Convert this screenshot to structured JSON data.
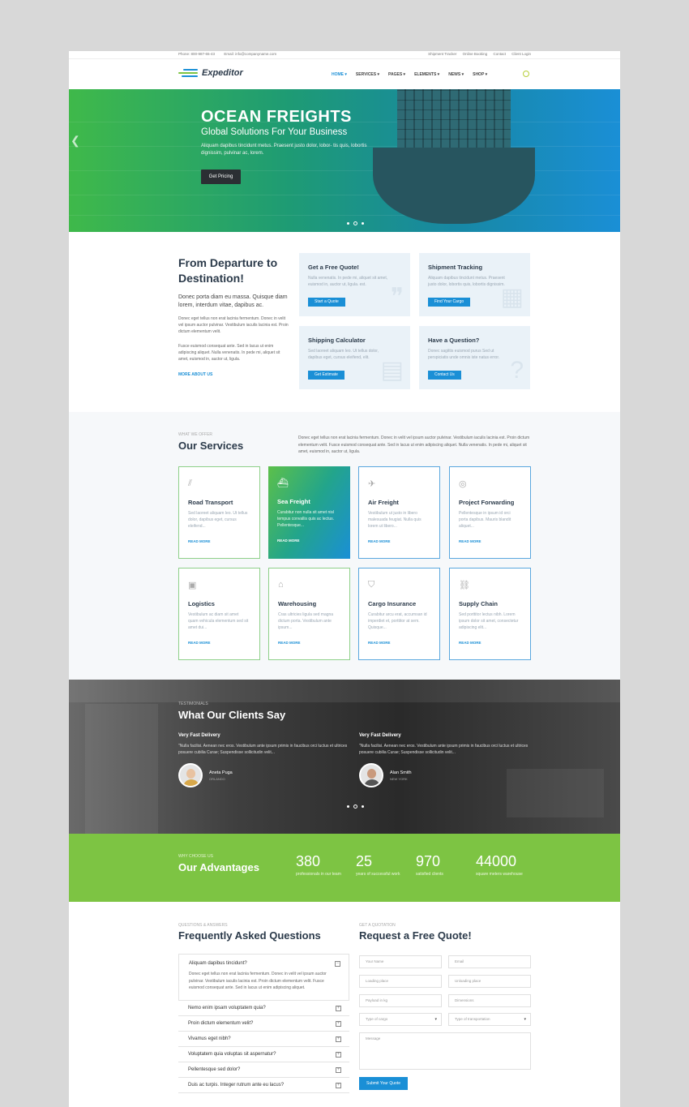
{
  "topbar": {
    "phone": "Phone: 800-987-65-43",
    "email": "Email: info@companyname.com",
    "links": [
      "Shipment Tracker",
      "Online Booking",
      "Contact",
      "Client Login"
    ]
  },
  "brand": {
    "name": "Expeditor",
    "accent": "#1a8fd6",
    "green": "#7dc443"
  },
  "nav": [
    "HOME",
    "SERVICES",
    "PAGES",
    "ELEMENTS",
    "NEWS",
    "SHOP"
  ],
  "hero": {
    "title": "OCEAN FREIGHTS",
    "subtitle": "Global Solutions For Your Business",
    "text": "Aliquam dapibus tincidunt metus. Praesent justo dolor, lobor- tis quis, lobortis dignissim, pulvinar ac, lorem.",
    "button": "Get Pricing"
  },
  "departure": {
    "title": "From Departure to Destination!",
    "lead": "Donec porta diam eu massa. Quisque diam lorem, interdum vitae, dapibus ac.",
    "p1": "Donec eget tellus non erat lacinia fermentum. Donec in velit vel ipsum auctor pulvinar. Vestibulum iaculis lacinia est. Proin dictum elementum velit.",
    "p2": "Fusce euismod consequat ante. Sed in lacus ut enim adipiscing aliquet. Nulla venenatis. In pede mi, aliquet sit amet, euismod in, auctor ut, ligula.",
    "link": "MORE ABOUT US"
  },
  "quick": [
    {
      "title": "Get a Free Quote!",
      "text": "Nulla venenatis. In pede mi, aliquet sit amet, euismod in, auctor ut, ligula. est.",
      "button": "Start a Quote"
    },
    {
      "title": "Shipment Tracking",
      "text": "Aliquam dapibus tincidunt metus. Praesent justo dolor, lobortis quis, lobortis dignissim.",
      "button": "Find Your Cargo"
    },
    {
      "title": "Shipping Calculator",
      "text": "Sed laoreet aliquam leo. Ut tellus dolor, dapibus eget, cursus eleifend, elit.",
      "button": "Get Estimate"
    },
    {
      "title": "Have a Question?",
      "text": "Donec sagittis euismod purus Sed ut perspiciatis unde omnis iste natus error.",
      "button": "Contact Us"
    }
  ],
  "services": {
    "label": "WHAT WE OFFER",
    "title": "Our Services",
    "intro": "Donec eget tellus non erat lacinia fermentum. Donec in velit vel ipsum auctor pulvinar. Vestibulum iaculis lacinia est. Proin dictum elementum velit. Fusce euismod consequat ante. Sed in lacus ut enim adipiscing aliquet. Nulla venenatis. In pede mi, aliquet sit amet, euismod in, auctor ut, ligula.",
    "read_more": "READ MORE",
    "items": [
      {
        "title": "Road Transport",
        "text": "Sed laoreet aliquam leo. Ut tellus dolor, dapibus eget, cursus eleifend...",
        "icon": "road-icon"
      },
      {
        "title": "Sea Freight",
        "text": "Curabitur non nulla sit amet nisl tempus convallis quis ac lectus. Pellentesque...",
        "icon": "ship-icon"
      },
      {
        "title": "Air Freight",
        "text": "Vestibulum ut justo in libero malesuada feugiat. Nulla quis lorem ut libero...",
        "icon": "plane-icon"
      },
      {
        "title": "Project Forwarding",
        "text": "Pellentesque in ipsum id orci porta dapibus. Mauris blandit aliquet...",
        "icon": "globe-icon"
      },
      {
        "title": "Logistics",
        "text": "Vestibulum ac diam sit amet quam vehicula elementum sed sit amet dui...",
        "icon": "logistics-icon"
      },
      {
        "title": "Warehousing",
        "text": "Cras ultricies ligula sed magna dictum porta. Vestibulum ante ipsum...",
        "icon": "warehouse-icon"
      },
      {
        "title": "Cargo Insurance",
        "text": "Curabitur arcu erat, accumsan id imperdiet et, porttitor at sem. Quisque...",
        "icon": "shield-icon"
      },
      {
        "title": "Supply Chain",
        "text": "Sed porttitor lectus nibh. Lorem ipsum dolor sit amet, consectetur adipiscing elit...",
        "icon": "chain-icon"
      }
    ]
  },
  "testimonials": {
    "label": "TESTIMONIALS",
    "title": "What Our Clients Say",
    "items": [
      {
        "heading": "Very Fast Delivery",
        "quote": "\"Nulla facilisi. Aenean nec eros. Vestibulum ante ipsum primis in faucibus orci luctus et ultrices posuere cubilia Curae; Suspendisse sollicitudin velit...",
        "name": "Aneta Puga",
        "city": "ORLANDO"
      },
      {
        "heading": "Very Fast Delivery",
        "quote": "\"Nulla facilisi. Aenean nec eros. Vestibulum ante ipsum primis in faucibus orci luctus et ultrices posuere cubilia Curae; Suspendisse sollicitudin velit...",
        "name": "Alan Smith",
        "city": "NEW YORK"
      }
    ]
  },
  "advantages": {
    "label": "WHY CHOOSE US",
    "title": "Our Advantages",
    "stats": [
      {
        "value": "380",
        "label": "professionals in our team"
      },
      {
        "value": "25",
        "label": "years of successful work"
      },
      {
        "value": "970",
        "label": "satisfied clients"
      },
      {
        "value": "44000",
        "label": "square meters warehouse"
      }
    ]
  },
  "faq": {
    "label": "QUESTIONS & ANSWERS",
    "title": "Frequently Asked Questions",
    "open_q": "Aliquam dapibus tincidunt?",
    "open_a": "Donec eget tellus non erat lacinia fermentum. Donec in velit vel ipsum auctor pulvinar. Vestibulum iaculis lacinia est. Proin dictum elementum velit. Fusce euismod consequat ante. Sed in lacus ut enim adipiscing aliquet.",
    "items": [
      "Nemo enim ipsam voluptatem quia?",
      "Proin dictum elementum velit?",
      "Vivamus eget nibh?",
      "Voluptatem quia voluptas sit aspernatur?",
      "Pellentesque sed dolor?",
      "Duis ac turpis. Integer rutrum ante eu lacus?"
    ]
  },
  "quote": {
    "label": "GET A QUOTATION",
    "title": "Request a Free Quote!",
    "fields": {
      "name": "Your Name",
      "email": "Email",
      "loading": "Loading place",
      "unloading": "Unloading place",
      "payload": "Payload in kg",
      "dimensions": "Dimensions",
      "cargo_type": "Type of cargo",
      "transport_type": "Type of transportation",
      "message": "Message"
    },
    "submit": "Submit Your Quote"
  }
}
